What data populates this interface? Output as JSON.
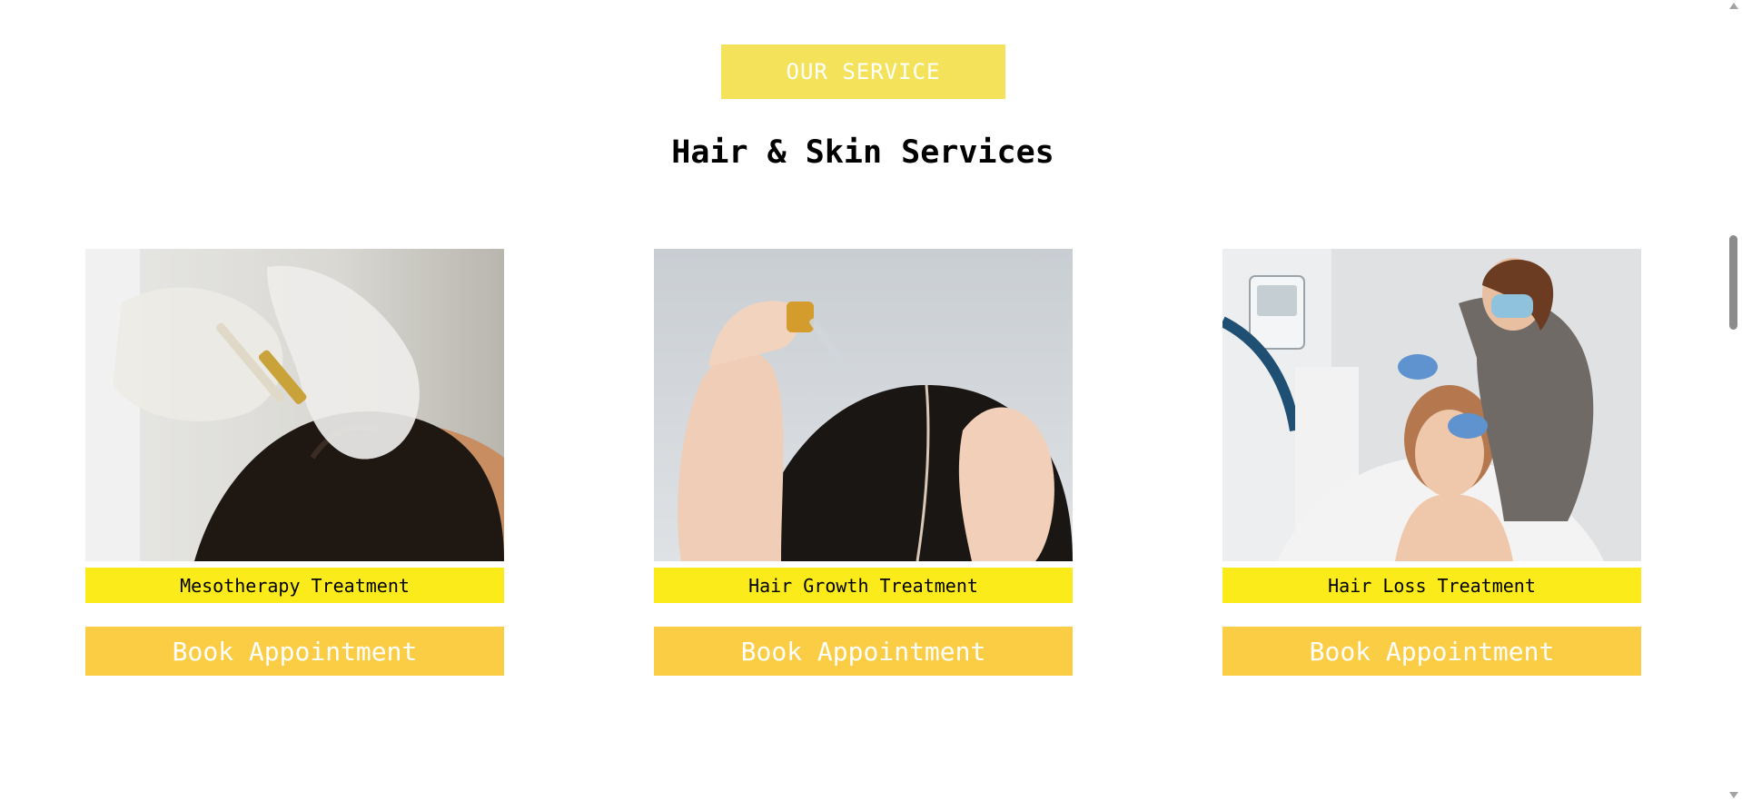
{
  "section": {
    "badge": "OUR SERVICE",
    "title": "Hair & Skin Services"
  },
  "services": [
    {
      "label": "Mesotherapy Treatment",
      "button": "Book Appointment",
      "image": "mesotherapy-photo"
    },
    {
      "label": "Hair Growth Treatment",
      "button": "Book Appointment",
      "image": "hair-growth-photo"
    },
    {
      "label": "Hair Loss Treatment",
      "button": "Book Appointment",
      "image": "hair-loss-photo"
    }
  ],
  "colors": {
    "badge_bg": "#f4e35a",
    "label_bg": "#fbeb1b",
    "button_bg": "#fbcd44"
  }
}
